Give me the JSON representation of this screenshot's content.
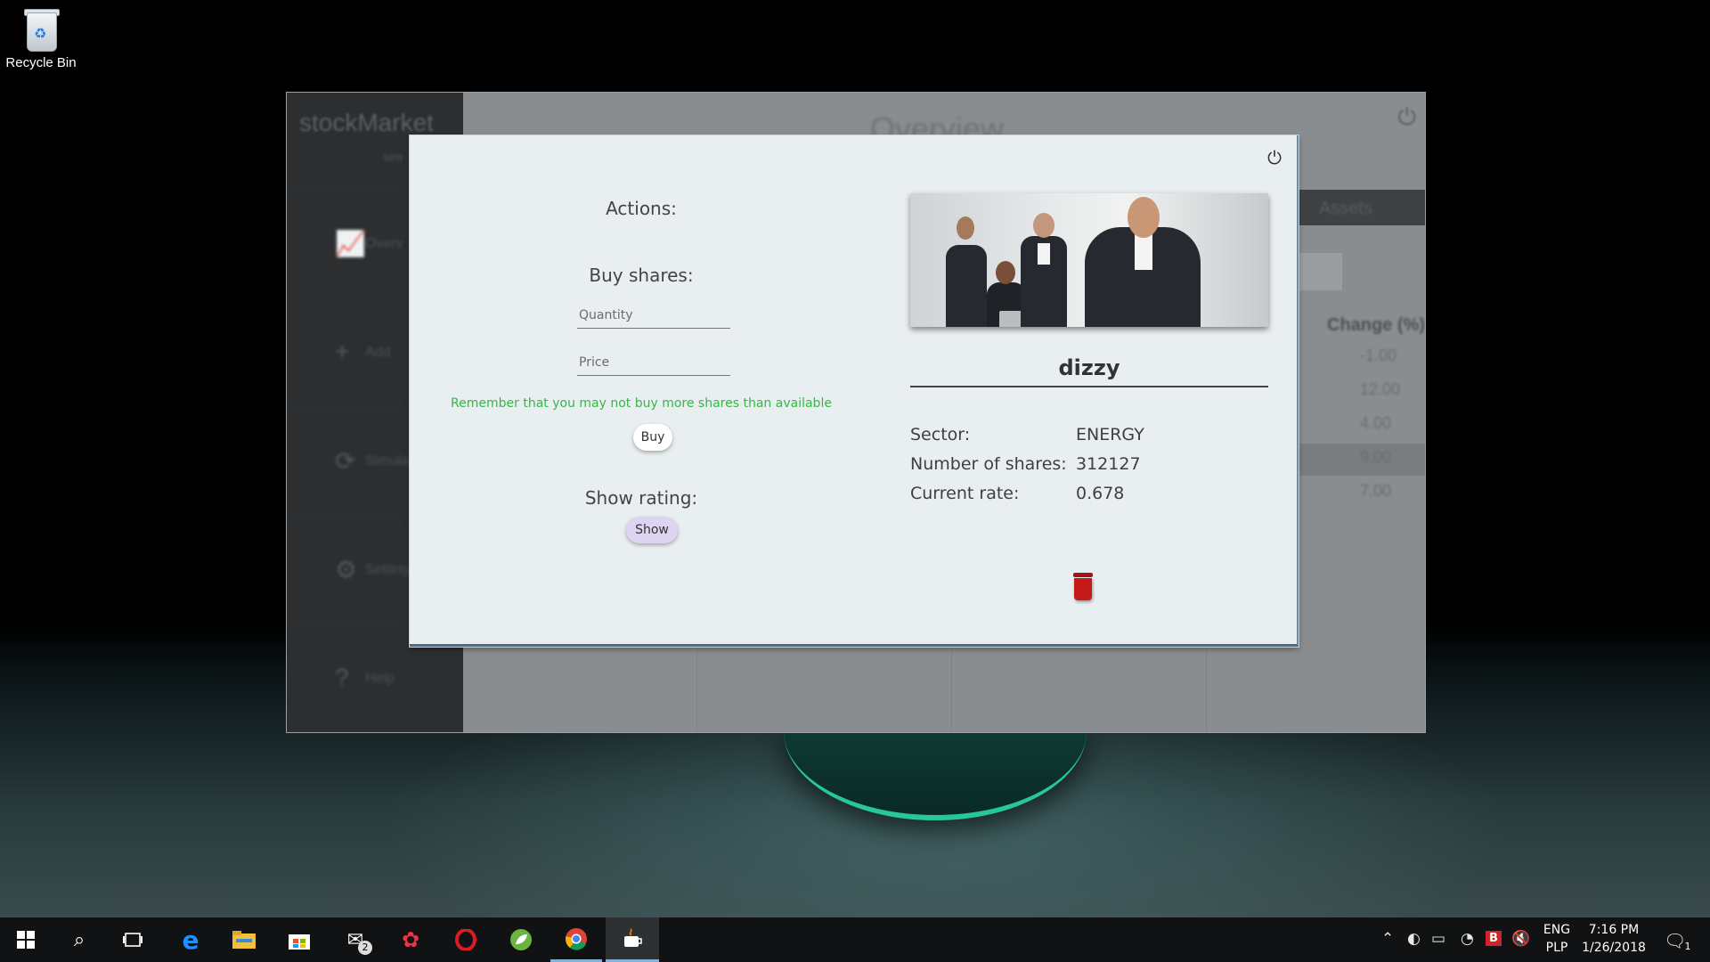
{
  "desktop": {
    "recycle_bin_label": "Recycle Bin"
  },
  "background_app": {
    "logo": "stockMarket",
    "logo_sub": "sim",
    "title": "Overview",
    "nav": [
      {
        "label": "Overv",
        "icon": "chart-icon"
      },
      {
        "label": "Add",
        "icon": "plus-icon"
      },
      {
        "label": "Simula",
        "icon": "refresh-icon"
      },
      {
        "label": "Setting",
        "icon": "gear-icon"
      },
      {
        "label": "Help",
        "icon": "help-icon"
      }
    ],
    "assets_tab": "Assets",
    "change_header": "Change (%)",
    "change_values": [
      "-1.00",
      "12.00",
      "4.00",
      "9.00",
      "7.00"
    ]
  },
  "dialog": {
    "actions_title": "Actions:",
    "buy_title": "Buy shares:",
    "quantity_placeholder": "Quantity",
    "price_placeholder": "Price",
    "note": "Remember that you may not buy more shares than available",
    "buy_label": "Buy",
    "rating_title": "Show rating:",
    "show_label": "Show",
    "company_name": "dizzy",
    "info": [
      {
        "label": "Sector:",
        "value": "ENERGY"
      },
      {
        "label": "Number of shares:",
        "value": "312127"
      },
      {
        "label": "Current rate:",
        "value": "0.678"
      }
    ],
    "note_color": "#39b54a",
    "delete_color": "#c61a1a"
  },
  "taskbar": {
    "mail_badge": "2",
    "lang_primary": "ENG",
    "lang_secondary": "PLP",
    "time": "7:16 PM",
    "date": "1/26/2018",
    "notification_count": "1"
  }
}
